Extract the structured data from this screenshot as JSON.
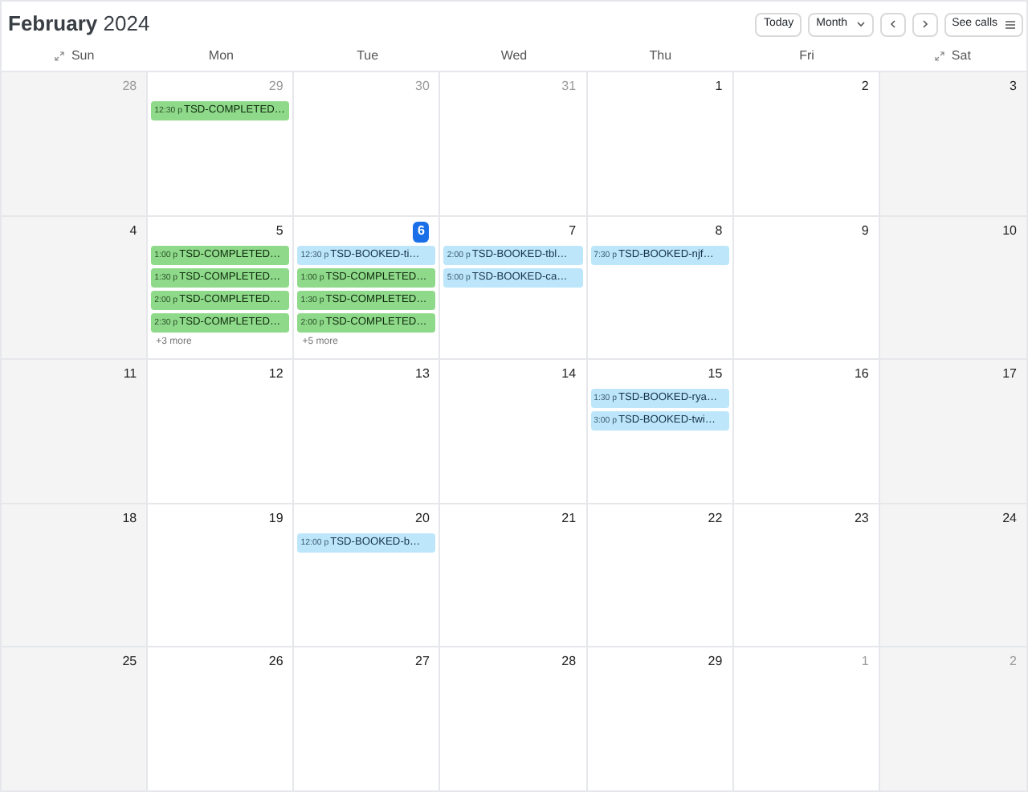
{
  "title": "**February** 2024",
  "toolbar": {
    "today": "Today",
    "view": "Month",
    "see_calls": "See calls"
  },
  "weekdays": [
    {
      "label": "Sun",
      "collapsible": true
    },
    {
      "label": "Mon",
      "collapsible": false
    },
    {
      "label": "Tue",
      "collapsible": false
    },
    {
      "label": "Wed",
      "collapsible": false
    },
    {
      "label": "Thu",
      "collapsible": false
    },
    {
      "label": "Fri",
      "collapsible": false
    },
    {
      "label": "Sat",
      "collapsible": true
    }
  ],
  "weeks": [
    [
      {
        "day": "28",
        "in_month": false,
        "selected": false
      },
      {
        "day": "29",
        "in_month": false,
        "selected": false,
        "events": [
          {
            "kind": "completed",
            "time": "12:30 p",
            "title": "TSD-COMPLETED…"
          }
        ]
      },
      {
        "day": "30",
        "in_month": false,
        "selected": false
      },
      {
        "day": "31",
        "in_month": false,
        "selected": false
      },
      {
        "day": "1",
        "in_month": true,
        "selected": false
      },
      {
        "day": "2",
        "in_month": true,
        "selected": false
      },
      {
        "day": "3",
        "in_month": true,
        "selected": false
      }
    ],
    [
      {
        "day": "4",
        "in_month": true,
        "selected": false
      },
      {
        "day": "5",
        "in_month": true,
        "selected": false,
        "events": [
          {
            "kind": "completed",
            "time": "1:00 p",
            "title": "TSD-COMPLETED…"
          },
          {
            "kind": "completed",
            "time": "1:30 p",
            "title": "TSD-COMPLETED…"
          },
          {
            "kind": "completed",
            "time": "2:00 p",
            "title": "TSD-COMPLETED…"
          },
          {
            "kind": "completed",
            "time": "2:30 p",
            "title": "TSD-COMPLETED…"
          }
        ],
        "more": "+3 more"
      },
      {
        "day": "6",
        "in_month": true,
        "selected": true,
        "events": [
          {
            "kind": "booked",
            "time": "12:30 p",
            "title": "TSD-BOOKED-ti…"
          },
          {
            "kind": "completed",
            "time": "1:00 p",
            "title": "TSD-COMPLETED…"
          },
          {
            "kind": "completed",
            "time": "1:30 p",
            "title": "TSD-COMPLETED…"
          },
          {
            "kind": "completed",
            "time": "2:00 p",
            "title": "TSD-COMPLETED…"
          }
        ],
        "more": "+5 more"
      },
      {
        "day": "7",
        "in_month": true,
        "selected": false,
        "events": [
          {
            "kind": "booked",
            "time": "2:00 p",
            "title": "TSD-BOOKED-tbl…"
          },
          {
            "kind": "booked",
            "time": "5:00 p",
            "title": "TSD-BOOKED-ca…"
          }
        ]
      },
      {
        "day": "8",
        "in_month": true,
        "selected": false,
        "events": [
          {
            "kind": "booked",
            "time": "7:30 p",
            "title": "TSD-BOOKED-njf…"
          }
        ]
      },
      {
        "day": "9",
        "in_month": true,
        "selected": false
      },
      {
        "day": "10",
        "in_month": true,
        "selected": false
      }
    ],
    [
      {
        "day": "11",
        "in_month": true,
        "selected": false
      },
      {
        "day": "12",
        "in_month": true,
        "selected": false
      },
      {
        "day": "13",
        "in_month": true,
        "selected": false
      },
      {
        "day": "14",
        "in_month": true,
        "selected": false
      },
      {
        "day": "15",
        "in_month": true,
        "selected": false,
        "events": [
          {
            "kind": "booked",
            "time": "1:30 p",
            "title": "TSD-BOOKED-rya…"
          },
          {
            "kind": "booked",
            "time": "3:00 p",
            "title": "TSD-BOOKED-twi…"
          }
        ]
      },
      {
        "day": "16",
        "in_month": true,
        "selected": false
      },
      {
        "day": "17",
        "in_month": true,
        "selected": false
      }
    ],
    [
      {
        "day": "18",
        "in_month": true,
        "selected": false
      },
      {
        "day": "19",
        "in_month": true,
        "selected": false
      },
      {
        "day": "20",
        "in_month": true,
        "selected": false,
        "events": [
          {
            "kind": "booked",
            "time": "12:00 p",
            "title": "TSD-BOOKED-b…"
          }
        ]
      },
      {
        "day": "21",
        "in_month": true,
        "selected": false
      },
      {
        "day": "22",
        "in_month": true,
        "selected": false
      },
      {
        "day": "23",
        "in_month": true,
        "selected": false
      },
      {
        "day": "24",
        "in_month": true,
        "selected": false
      }
    ],
    [
      {
        "day": "25",
        "in_month": true,
        "selected": false
      },
      {
        "day": "26",
        "in_month": true,
        "selected": false
      },
      {
        "day": "27",
        "in_month": true,
        "selected": false
      },
      {
        "day": "28",
        "in_month": true,
        "selected": false
      },
      {
        "day": "29",
        "in_month": true,
        "selected": false
      },
      {
        "day": "1",
        "in_month": false,
        "selected": false
      },
      {
        "day": "2",
        "in_month": false,
        "selected": false
      }
    ]
  ]
}
